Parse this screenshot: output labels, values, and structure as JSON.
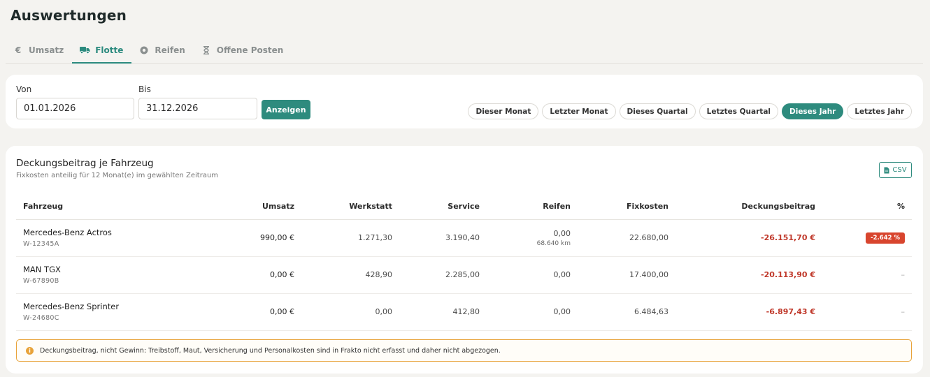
{
  "page": {
    "title": "Auswertungen"
  },
  "tabs": [
    {
      "label": "Umsatz",
      "icon": "euro-icon"
    },
    {
      "label": "Flotte",
      "icon": "truck-icon",
      "active": true
    },
    {
      "label": "Reifen",
      "icon": "tire-icon"
    },
    {
      "label": "Offene Posten",
      "icon": "hourglass-icon"
    }
  ],
  "filter": {
    "from_label": "Von",
    "from_value": "01.01.2026",
    "to_label": "Bis",
    "to_value": "31.12.2026",
    "submit_label": "Anzeigen",
    "presets": [
      "Dieser Monat",
      "Letzter Monat",
      "Dieses Quartal",
      "Letztes Quartal",
      "Dieses Jahr",
      "Letztes Jahr"
    ],
    "active_preset": "Dieses Jahr"
  },
  "report": {
    "title": "Deckungsbeitrag je Fahrzeug",
    "subtitle": "Fixkosten anteilig für 12 Monat(e) im gewählten Zeitraum",
    "csv_label": "CSV",
    "columns": [
      "Fahrzeug",
      "Umsatz",
      "Werkstatt",
      "Service",
      "Reifen",
      "Fixkosten",
      "Deckungsbeitrag",
      "%"
    ],
    "rows": [
      {
        "name": "Mercedes-Benz Actros",
        "plate": "W-12345A",
        "umsatz": "990,00 €",
        "werkstatt": "1.271,30",
        "service": "3.190,40",
        "reifen": "0,00",
        "reifen_km": "68.640 km",
        "fixkosten": "22.680,00",
        "deckungsbeitrag": "-26.151,70 €",
        "pct": "-2.642 %"
      },
      {
        "name": "MAN TGX",
        "plate": "W-67890B",
        "umsatz": "0,00 €",
        "werkstatt": "428,90",
        "service": "2.285,00",
        "reifen": "0,00",
        "reifen_km": "",
        "fixkosten": "17.400,00",
        "deckungsbeitrag": "-20.113,90 €",
        "pct": "–"
      },
      {
        "name": "Mercedes-Benz Sprinter",
        "plate": "W-24680C",
        "umsatz": "0,00 €",
        "werkstatt": "0,00",
        "service": "412,80",
        "reifen": "0,00",
        "reifen_km": "",
        "fixkosten": "6.484,63",
        "deckungsbeitrag": "-6.897,43 €",
        "pct": "–"
      }
    ],
    "notice": "Deckungsbeitrag, nicht Gewinn: Treibstoff, Maut, Versicherung und Personalkosten sind in Frakto nicht erfasst und daher nicht abgezogen."
  },
  "colors": {
    "accent": "#2e8b7e",
    "negative": "#c0392b",
    "badge": "#d8452e",
    "warning_border": "#e8a33a"
  }
}
